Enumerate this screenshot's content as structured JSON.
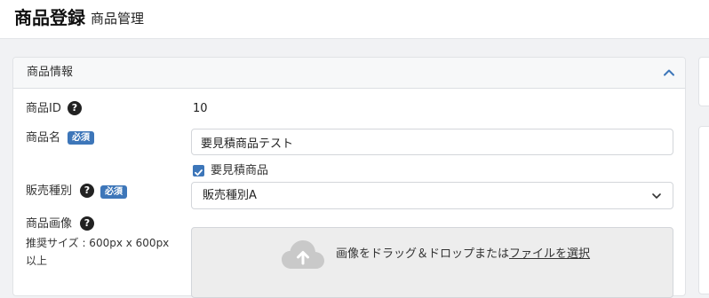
{
  "header": {
    "title": "商品登録",
    "subtitle": "商品管理"
  },
  "section": {
    "title": "商品情報",
    "collapse_icon": "chevron-up-icon"
  },
  "fields": {
    "product_id": {
      "label": "商品ID",
      "value": "10"
    },
    "product_name": {
      "label": "商品名",
      "required": "必須",
      "value": "要見積商品テスト"
    },
    "quote_required": {
      "label": "要見積商品",
      "checked": true
    },
    "sales_type": {
      "label": "販売種別",
      "required": "必須",
      "selected": "販売種別A"
    },
    "product_image": {
      "label": "商品画像",
      "hint": "推奨サイズ : 600px x 600px以上",
      "dropzone_text": "画像をドラッグ＆ドロップまたは",
      "dropzone_link": "ファイルを選択"
    }
  },
  "colors": {
    "accent": "#3d76b9",
    "background": "#f1f2f4"
  }
}
